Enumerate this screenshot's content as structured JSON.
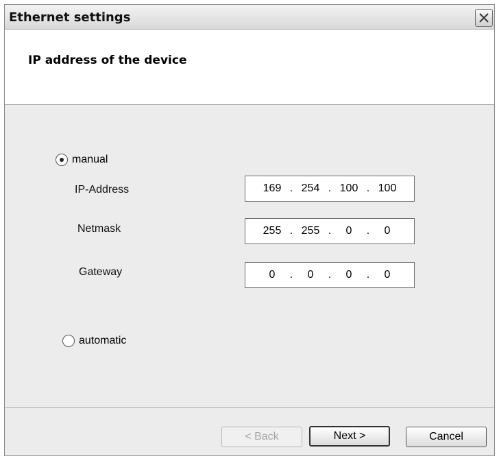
{
  "window": {
    "title": "Ethernet settings"
  },
  "header": {
    "title": "IP address of the device"
  },
  "mode": {
    "manual_label": "manual",
    "automatic_label": "automatic",
    "selected": "manual"
  },
  "fields": {
    "ip": {
      "label": "IP-Address",
      "octets": [
        "169",
        "254",
        "100",
        "100"
      ]
    },
    "netmask": {
      "label": "Netmask",
      "octets": [
        "255",
        "255",
        "0",
        "0"
      ]
    },
    "gateway": {
      "label": "Gateway",
      "octets": [
        "0",
        "0",
        "0",
        "0"
      ]
    }
  },
  "buttons": {
    "back": "< Back",
    "next": "Next >",
    "cancel": "Cancel"
  },
  "icons": {
    "close": "close-icon"
  }
}
